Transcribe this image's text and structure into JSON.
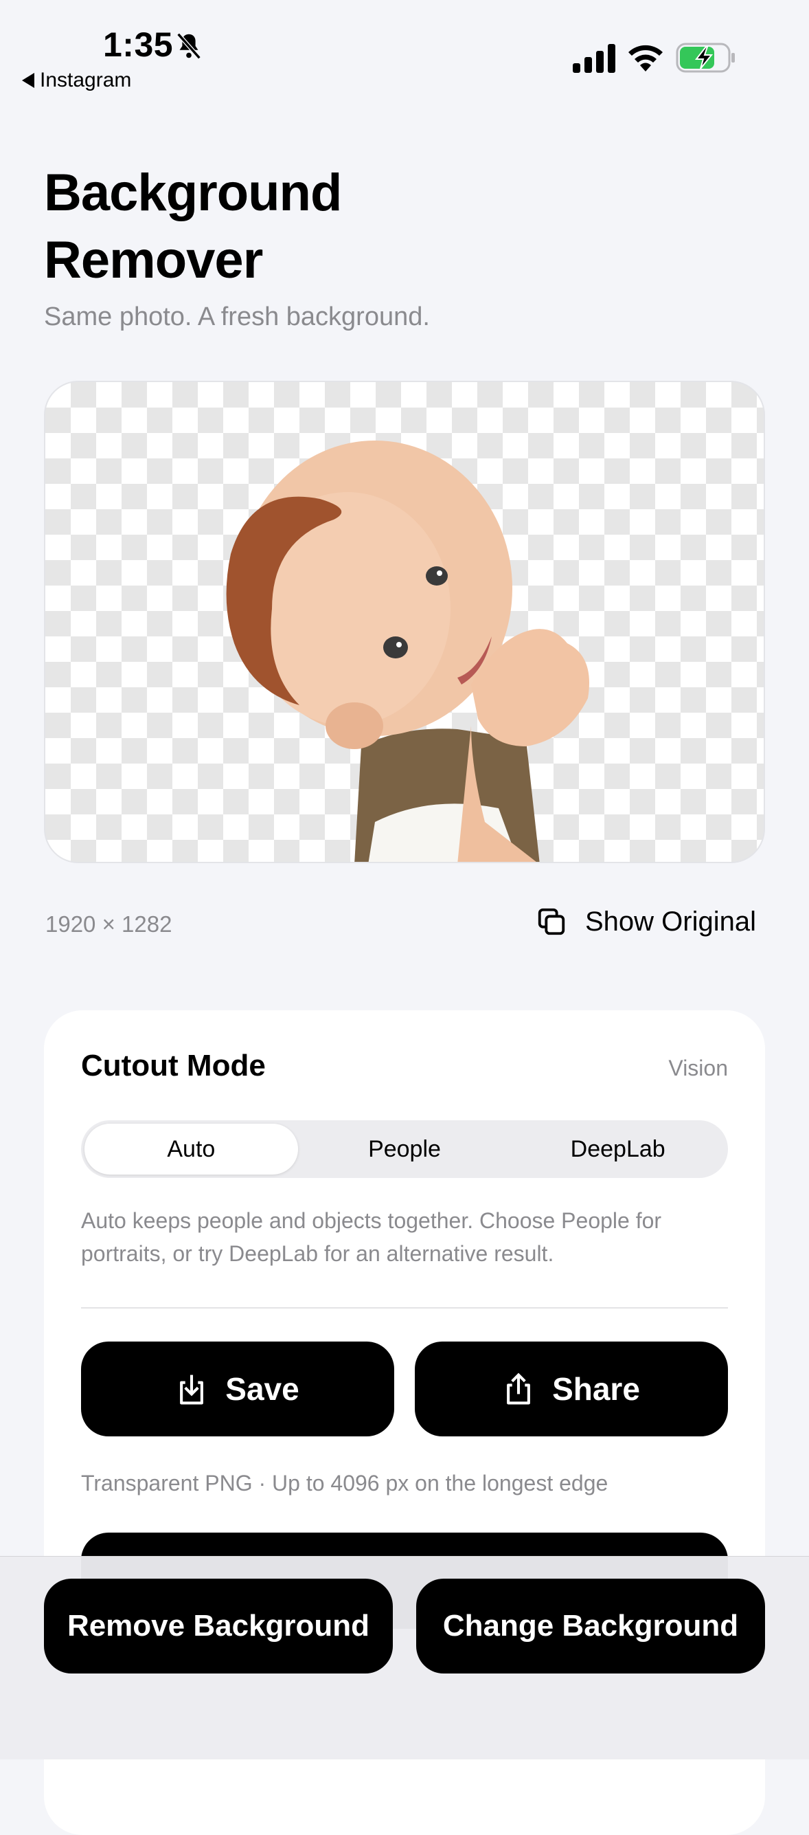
{
  "status_bar": {
    "time": "1:35",
    "back_app": "Instagram",
    "icons": [
      "bell-slash-icon",
      "signal-icon",
      "wifi-icon",
      "battery-charging-icon"
    ]
  },
  "header": {
    "title_line1": "Background",
    "title_line2": "Remover",
    "subtitle": "Same photo. A fresh background."
  },
  "preview": {
    "dimensions": "1920 × 1282",
    "show_original_label": "Show Original"
  },
  "cutout_card": {
    "title": "Cutout Mode",
    "engine": "Vision",
    "modes": [
      {
        "label": "Auto",
        "selected": true
      },
      {
        "label": "People",
        "selected": false
      },
      {
        "label": "DeepLab",
        "selected": false
      }
    ],
    "description": "Auto keeps people and objects together. Choose People for portraits, or try DeepLab for an alternative result.",
    "save_label": "Save",
    "share_label": "Share",
    "export_note": "Transparent PNG · Up to 4096 px on the longest edge"
  },
  "bottom_bar": {
    "remove_label": "Remove Background",
    "change_label": "Change Background"
  },
  "colors": {
    "background": "#f4f5f9",
    "button": "#000000",
    "secondary_text": "#8a8a8e",
    "battery_green": "#34c759"
  }
}
